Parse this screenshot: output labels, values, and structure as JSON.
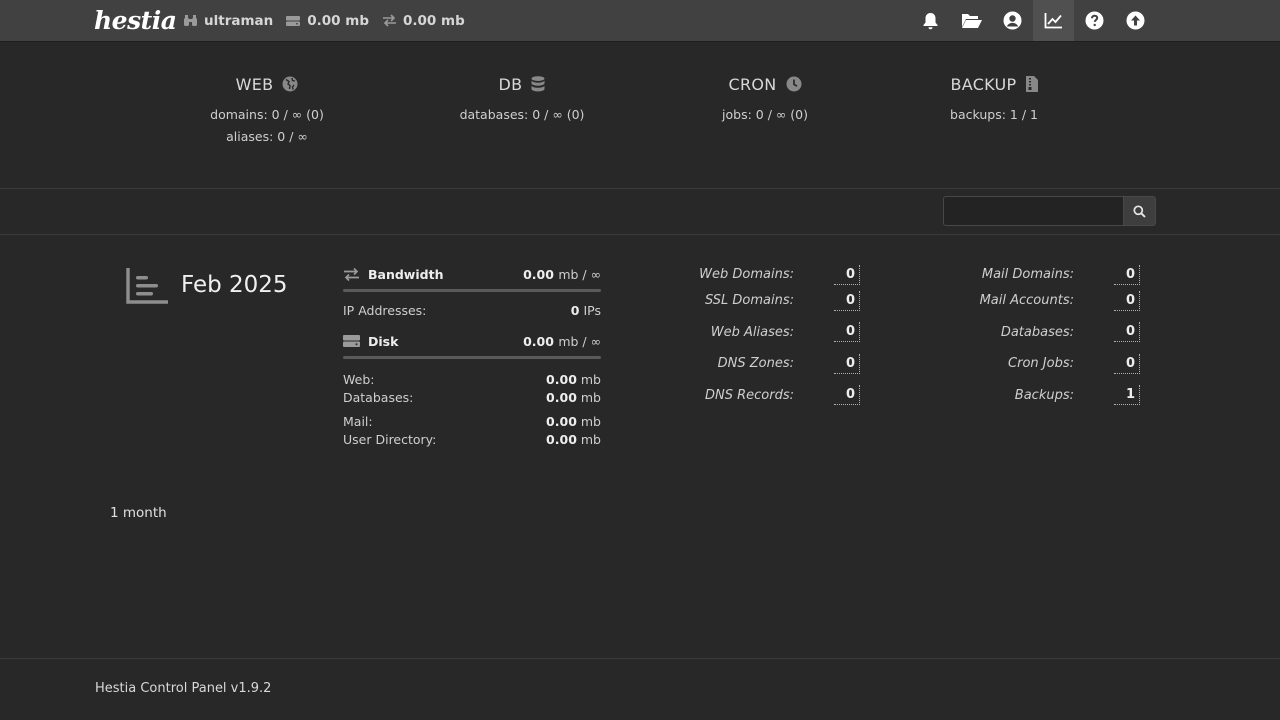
{
  "app": {
    "logo_text": "hestia"
  },
  "top_bar": {
    "username": "ultraman",
    "disk_usage": "0.00 mb",
    "bandwidth_usage": "0.00 mb",
    "nav": [
      {
        "name": "notifications",
        "icon": "bell-icon"
      },
      {
        "name": "file-manager",
        "icon": "folder-open-icon"
      },
      {
        "name": "user-profile",
        "icon": "user-circle-icon"
      },
      {
        "name": "statistics",
        "icon": "chart-line-icon",
        "active": true
      },
      {
        "name": "help",
        "icon": "question-circle-icon"
      },
      {
        "name": "logout",
        "icon": "arrow-up-circle-icon"
      }
    ]
  },
  "summary": {
    "web": {
      "title": "WEB",
      "line1": "domains: 0 / ∞ (0)",
      "line2": "aliases: 0 / ∞"
    },
    "db": {
      "title": "DB",
      "line1": "databases: 0 / ∞ (0)"
    },
    "cron": {
      "title": "CRON",
      "line1": "jobs: 0 / ∞ (0)"
    },
    "backup": {
      "title": "BACKUP",
      "line1": "backups: 1 / 1"
    }
  },
  "search": {
    "placeholder": "",
    "value": ""
  },
  "stats": {
    "period": "Feb 2025",
    "range": "1 month",
    "bandwidth": {
      "label": "Bandwidth",
      "value": "0.00",
      "unit": "mb / ∞"
    },
    "ip_addresses": {
      "label": "IP Addresses:",
      "value": "0",
      "unit": "IPs"
    },
    "disk": {
      "label": "Disk",
      "value": "0.00",
      "unit": "mb / ∞"
    },
    "disk_breakdown": [
      {
        "label": "Web:",
        "value": "0.00",
        "unit": "mb"
      },
      {
        "label": "Databases:",
        "value": "0.00",
        "unit": "mb"
      },
      {
        "label": "Mail:",
        "value": "0.00",
        "unit": "mb"
      },
      {
        "label": "User Directory:",
        "value": "0.00",
        "unit": "mb"
      }
    ],
    "counts_left": [
      {
        "label": "Web Domains:",
        "value": "0"
      },
      {
        "label": "SSL Domains:",
        "value": "0"
      },
      {
        "label": "Web Aliases:",
        "value": "0"
      },
      {
        "label": "DNS Zones:",
        "value": "0"
      },
      {
        "label": "DNS Records:",
        "value": "0"
      }
    ],
    "counts_right": [
      {
        "label": "Mail Domains:",
        "value": "0"
      },
      {
        "label": "Mail Accounts:",
        "value": "0"
      },
      {
        "label": "Databases:",
        "value": "0"
      },
      {
        "label": "Cron Jobs:",
        "value": "0"
      },
      {
        "label": "Backups:",
        "value": "1"
      }
    ]
  },
  "footer": {
    "text": "Hestia Control Panel v1.9.2"
  }
}
